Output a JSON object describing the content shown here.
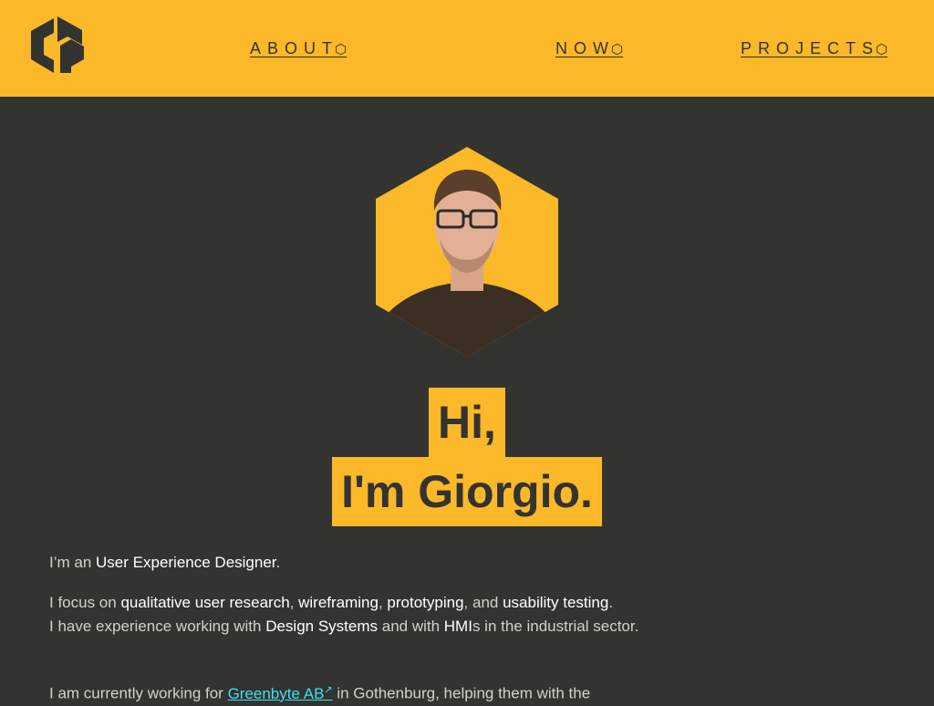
{
  "nav": {
    "logo_label": "Logo",
    "items": [
      {
        "label": "ABOUT",
        "icon": "⬡"
      },
      {
        "label": "NOW",
        "icon": "⬡"
      },
      {
        "label": "PROJECTS",
        "icon": "⬡"
      }
    ]
  },
  "hero": {
    "greeting_line1": "Hi,",
    "greeting_line2": "I'm Giorgio.",
    "photo": "portrait-photo"
  },
  "bio": {
    "p1_prefix": "I’m an ",
    "p1_role": "User Experience Designer",
    "p1_suffix": ".",
    "p2_a": "I focus on ",
    "p2_b": "qualitative user research",
    "p2_c": ", ",
    "p2_d": "wireframing",
    "p2_e": ", ",
    "p2_f": "prototyping",
    "p2_g": ", and ",
    "p2_h": "usability testing",
    "p2_i": ".",
    "p3_a": "I have experience working with ",
    "p3_b": "Design Systems",
    "p3_c": " and with ",
    "p3_d": "HMI",
    "p3_e": "s in the industrial sector.",
    "p4_a": "I am currently working for ",
    "p4_link": "Greenbyte AB",
    "p4_link_icon": "↗",
    "p4_b": " in Gothenburg, helping them with the"
  },
  "colors": {
    "accent": "#fbb829",
    "background": "#33332f",
    "link": "#3fe0f0"
  }
}
